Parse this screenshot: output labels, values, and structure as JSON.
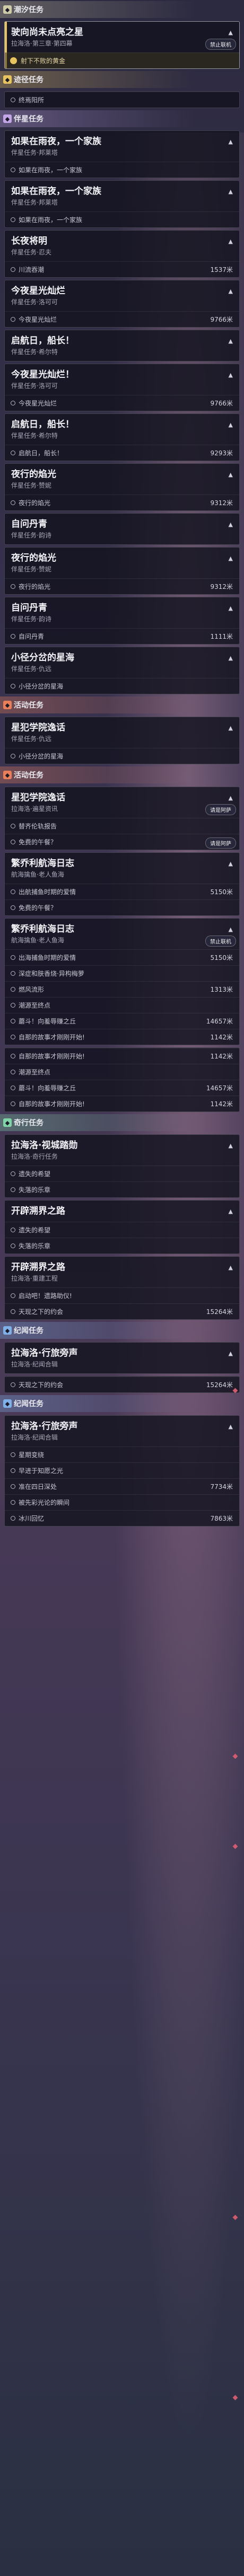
{
  "colors": {
    "tide": "#cfcaa8",
    "trail": "#e8c460",
    "companion": "#c2a6e8",
    "event": "#e87f5a",
    "adventure": "#7fd4a8",
    "chronicle": "#7fb0e8",
    "banner_highlight": "#e8c460"
  },
  "icons": {
    "section": "diamond-icon",
    "sub": "circle-icon",
    "gold": "coin-icon",
    "expand": "chevron-icon"
  },
  "tide": {
    "label": "潮汐任务",
    "card": {
      "title": "驶向尚未点亮之星",
      "sub": "拉海洛·第三章·第四幕",
      "gold": "射下不败的黄金",
      "badge": "禁止联机"
    }
  },
  "trail": {
    "label": "迹径任务",
    "items": [
      "终焉阳所"
    ]
  },
  "companion1": {
    "label": "伴星任务",
    "cards": [
      {
        "title": "如果在雨夜，一个家族",
        "sub": "伴星任务·邦莱塔",
        "items": [
          "如果在雨夜，一个家族"
        ]
      },
      {
        "title": "如果在雨夜，一个家族",
        "sub": "伴星任务·邦莱塔",
        "items": [
          "如果在雨夜，一个家族"
        ]
      },
      {
        "title": "长夜将明",
        "sub": "伴星任务·忍夫",
        "items": [
          {
            "t": "川流吞潮",
            "d": "1537米"
          }
        ]
      },
      {
        "title": "今夜星光灿烂",
        "sub": "伴星任务·洛可可",
        "items": [
          {
            "t": "今夜星光灿烂",
            "d": "9766米"
          }
        ]
      },
      {
        "title": "启航日，船长！",
        "sub": "伴星任务·希尔特",
        "items": []
      },
      {
        "title": "今夜星光灿烂！",
        "sub": "伴星任务·洛可可",
        "items": [
          {
            "t": "今夜星光灿烂",
            "d": "9766米"
          }
        ]
      },
      {
        "title": "启航日，船长！",
        "sub": "伴星任务·希尔特",
        "items": [
          {
            "t": "启航日，船长！",
            "d": "9293米"
          }
        ]
      },
      {
        "title": "夜行的焰光",
        "sub": "伴星任务·赞妮",
        "items": [
          {
            "t": "夜行的焰光",
            "d": "9312米"
          }
        ]
      },
      {
        "title": "自问丹青",
        "sub": "伴星任务·韵诗",
        "items": []
      },
      {
        "title": "夜行的焰光",
        "sub": "伴星任务·赞妮",
        "items": [
          {
            "t": "夜行的焰光",
            "d": "9312米"
          }
        ]
      },
      {
        "title": "自问丹青",
        "sub": "伴星任务·韵诗",
        "items": [
          {
            "t": "自问丹青",
            "d": "1111米"
          }
        ]
      },
      {
        "title": "小径分岔的星海",
        "sub": "伴星任务·仇远",
        "items": [
          {
            "t": "小径分岔的星海",
            "d": ""
          }
        ]
      }
    ]
  },
  "event1": {
    "label": "活动任务",
    "cards": [
      {
        "title": "星犯学院逸话",
        "sub": "伴星任务·仇远",
        "items": [
          {
            "t": "小径分岔的星海",
            "d": ""
          }
        ]
      }
    ]
  },
  "event2": {
    "label": "活动任务",
    "cards": [
      {
        "title": "星犯学院逸话",
        "sub": "拉海洛·遍星资讯",
        "badge": "请是阿萨",
        "items": [
          {
            "t": "替齐伦轨报告",
            "d": ""
          },
          {
            "t": "免费的午餐？",
            "d": "",
            "badge": "请是阿萨"
          }
        ]
      },
      {
        "title": "繁乔利航海日志",
        "sub": "航海擒鱼·老人鱼海",
        "items": [
          {
            "t": "出航捕鱼时期的爱情",
            "d": "5150米"
          },
          {
            "t": "免费的午餐？",
            "d": ""
          }
        ]
      },
      {
        "title": "繁乔利航海日志",
        "sub": "航海擒鱼·老人鱼海",
        "badge": "禁止联机",
        "items": [
          {
            "t": "出海捕鱼时期的爱情",
            "d": "5150米"
          },
          {
            "t": "深症和肤香烧·异构梅萝",
            "d": ""
          },
          {
            "t": "燃风流形",
            "d": "1313米"
          },
          {
            "t": "潮源至终点",
            "d": ""
          },
          {
            "t": "蘑斗！向羞辱赚之丘",
            "d": "14657米"
          },
          {
            "t": "自那的故事才刚刚开始!",
            "d": "1142米"
          }
        ]
      }
    ]
  },
  "standalone": [
    {
      "t": "自那的故事才刚刚开始!",
      "d": "1142米"
    },
    {
      "t": "潮源至终点",
      "d": ""
    },
    {
      "t": "蘑斗！向羞辱赚之丘",
      "d": "14657米"
    },
    {
      "t": "自那的故事才刚刚开始!",
      "d": "1142米"
    }
  ],
  "adventure": {
    "label": "奇行任务",
    "cards": [
      {
        "title": "拉海洛·视城踏勋",
        "sub": "拉海洛·奇行任务",
        "items": [
          {
            "t": "遗失的希望",
            "d": ""
          },
          {
            "t": "失落的乐章",
            "d": ""
          }
        ]
      },
      {
        "title": "开辟溯界之路",
        "sub": "",
        "items": [
          {
            "t": "遗失的希望",
            "d": ""
          },
          {
            "t": "失落的乐章",
            "d": ""
          }
        ]
      },
      {
        "title": "开辟溯界之路",
        "sub": "拉海洛·重建工程",
        "items": [
          {
            "t": "启动吧！遗路助仪!",
            "d": ""
          },
          {
            "t": "天现之下的约会",
            "d": "15264米"
          }
        ]
      }
    ]
  },
  "chronicle1": {
    "label": "纪闻任务",
    "cards": [
      {
        "title": "拉海洛·行旅旁声",
        "sub": "拉海洛·纪闻合辑",
        "items": []
      }
    ],
    "tail": [
      {
        "t": "天现之下的约会",
        "d": "15264米"
      }
    ]
  },
  "chronicle2": {
    "label": "纪闻任务",
    "cards": [
      {
        "title": "拉海洛·行旅旁声",
        "sub": "拉海洛·纪闻合辑",
        "items": [
          {
            "t": "星期变绕",
            "d": ""
          },
          {
            "t": "早进于知愿之光",
            "d": ""
          },
          {
            "t": "准在四日深处",
            "d": "7734米"
          },
          {
            "t": "被先彩光论的瞬间",
            "d": ""
          },
          {
            "t": "冰川回忆",
            "d": "7863米"
          }
        ]
      }
    ]
  }
}
